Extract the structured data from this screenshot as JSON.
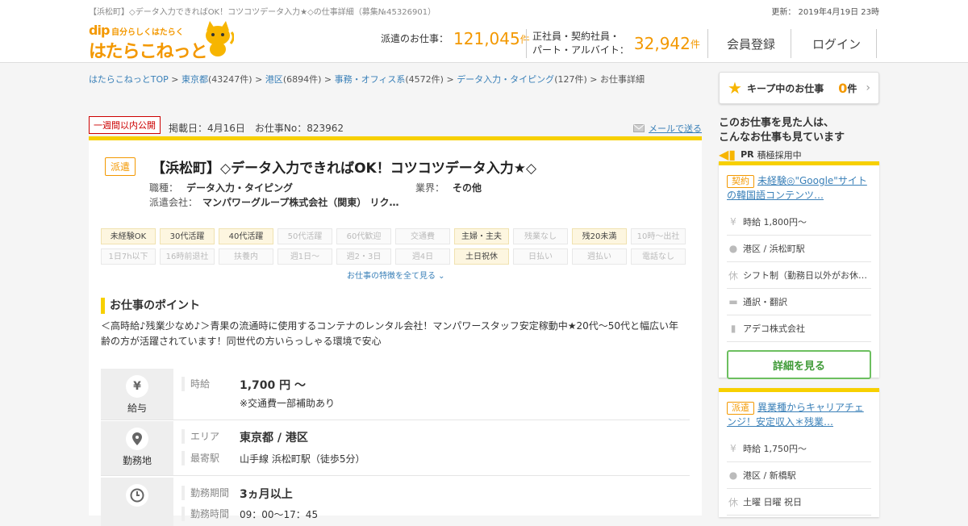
{
  "header": {
    "page_title": "【浜松町】◇データ入力できればOK！コツコツデータ入力★◇の仕事詳細（募集№45326901）",
    "update_label": "更新：",
    "update_date": "2019年4月19日 23時",
    "logo_dip": "dip",
    "logo_sub": "自分らしくはたらく",
    "logo_main": "はたらこねっと",
    "haken_label": "派遣のお仕事：",
    "haken_count": "121,045",
    "count_unit": "件",
    "sei_label1": "正社員・契約社員・",
    "sei_label2": "パート・アルバイト：",
    "sei_count": "32,942",
    "register": "会員登録",
    "login": "ログイン"
  },
  "breadcrumb": [
    {
      "text": "はたらこねっとTOP",
      "link": true
    },
    {
      "text": " > ",
      "link": false
    },
    {
      "text": "東京都",
      "link": true
    },
    {
      "text": "(43247件) > ",
      "link": false
    },
    {
      "text": "港区",
      "link": true
    },
    {
      "text": "(6894件) > ",
      "link": false
    },
    {
      "text": "事務・オフィス系",
      "link": true
    },
    {
      "text": "(4572件) > ",
      "link": false
    },
    {
      "text": "データ入力・タイピング",
      "link": true
    },
    {
      "text": "(127件) > お仕事詳細",
      "link": false
    }
  ],
  "keep": {
    "label": "キープ中のお仕事",
    "count": "0",
    "unit": "件"
  },
  "job": {
    "new_badge": "一週間以内公開",
    "pub": "掲載日：4月16日　お仕事No：823962",
    "mail": "メールで送る",
    "type": "派遣",
    "title": "【浜松町】◇データ入力できればOK！コツコツデータ入力★◇",
    "shokushu_label": "職種：",
    "shokushu": "データ入力・タイピング",
    "gyokai_label": "業界：",
    "gyokai": "その他",
    "company_label": "派遣会社：",
    "company": "マンパワーグループ株式会社（関東） リク…",
    "tags_row1": [
      {
        "t": "未経験OK",
        "on": true
      },
      {
        "t": "30代活躍",
        "on": true
      },
      {
        "t": "40代活躍",
        "on": true
      },
      {
        "t": "50代活躍",
        "on": false
      },
      {
        "t": "60代歓迎",
        "on": false
      },
      {
        "t": "交通費",
        "on": false
      },
      {
        "t": "主婦・主夫",
        "on": true
      },
      {
        "t": "残業なし",
        "on": false
      },
      {
        "t": "残20未満",
        "on": true
      },
      {
        "t": "10時～出社",
        "on": false
      }
    ],
    "tags_row2": [
      {
        "t": "1日7h以下",
        "on": false
      },
      {
        "t": "16時前退社",
        "on": false
      },
      {
        "t": "扶養内",
        "on": false
      },
      {
        "t": "週1日～",
        "on": false
      },
      {
        "t": "週2・3日",
        "on": false
      },
      {
        "t": "週4日",
        "on": false
      },
      {
        "t": "土日祝休",
        "on": true
      },
      {
        "t": "日払い",
        "on": false
      },
      {
        "t": "週払い",
        "on": false
      },
      {
        "t": "電話なし",
        "on": false
      }
    ],
    "show_all": "お仕事の特徴を全て見る ⌄",
    "point_heading": "お仕事のポイント",
    "point_text": "＜高時給♪残業少なめ♪＞青果の流通時に使用するコンテナのレンタル会社！マンパワースタッフ安定稼動中★20代～50代と幅広い年齢の方が活躍されています！同世代の方いらっしゃる環境で安心",
    "pay_title": "給与",
    "pay_label": "時給",
    "pay_value": "1,700 円 ～",
    "pay_note": "※交通費一部補助あり",
    "loc_title": "勤務地",
    "area_label": "エリア",
    "area_value": "東京都 / 港区",
    "station_label": "最寄駅",
    "station_value": "山手線 浜松町駅（徒歩5分）",
    "period_label": "勤務期間",
    "period_value": "3ヵ月以上",
    "time_label": "勤務時間",
    "time_value": "09：00～17：45"
  },
  "side": {
    "head1": "このお仕事を見た人は、",
    "head2": "こんなお仕事も見ています",
    "pr": "PR",
    "pr_text": "積極採用中",
    "card1": {
      "badge": "契約",
      "title": "未経験◎\"Google\"サイトの韓国語コンテンツ…",
      "items": [
        {
          "icon": "¥",
          "text": "時給 1,800円～"
        },
        {
          "icon": "●",
          "text": "港区 / 浜松町駅"
        },
        {
          "icon": "休",
          "text": "シフト制（勤務日以外がお休…"
        },
        {
          "icon": "▬",
          "text": "通訳・翻訳"
        },
        {
          "icon": "▮",
          "text": "アデコ株式会社"
        }
      ],
      "button": "詳細を見る"
    },
    "card2": {
      "badge": "派遣",
      "title": "異業種からキャリアチェンジ！安定収入＊残業…",
      "items": [
        {
          "icon": "¥",
          "text": "時給 1,750円～"
        },
        {
          "icon": "●",
          "text": "港区 / 新橋駅"
        },
        {
          "icon": "休",
          "text": "土曜 日曜 祝日"
        }
      ]
    }
  }
}
